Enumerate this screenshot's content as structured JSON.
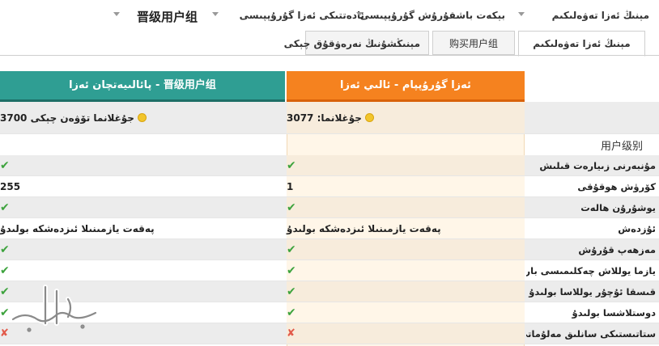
{
  "nav": {
    "crumbs": [
      "مېنىڭ ئەزا تەۋەلىكىم",
      "晋级用户组",
      "ئادەتتىكى ئەزا گۇرۇپپىسى",
      "بېكەت باشقۇرۇش گۇرۇپپىسى"
    ]
  },
  "tabs": [
    {
      "label": "مېنىڭ ئەزا تەۋەلىكىم",
      "active": true
    },
    {
      "label": "购买用户组",
      "active": false
    },
    {
      "label": "مېنىڭشۇنىڭ نەرەۋقۇق چېكى",
      "active": false
    }
  ],
  "columns": {
    "current": {
      "header": "ئەزا گۇرۇپپام - ئالىي ئەزا",
      "points_label": "جۇغلانما: 3077"
    },
    "next": {
      "header": "晋级用户组 - پائالىيەتچان ئەزا",
      "points_label": "جۇغلانما تۆۋەن چېكى 3700"
    }
  },
  "section_label": "用户级别",
  "rows": [
    {
      "label": "مۇنبەرنى زىيارەت قىلىش",
      "current": "✔",
      "next": "✔"
    },
    {
      "label": "كۆرۈش ھوقۇقى",
      "current": "1",
      "next": "255"
    },
    {
      "label": "يوشۇرۇن ھالەت",
      "current": "✔",
      "next": "✔"
    },
    {
      "label": "ئۇزدەش",
      "current": "پەقەت يازمىنىلا ئىزدەشكە بولىدۇ",
      "next": "پەقەت يازمىنىلا ئىزدەشكە بولىدۇ"
    },
    {
      "label": "مەزھەپ قۇرۇش",
      "current": "✔",
      "next": "✔"
    },
    {
      "label": "يازما يوللاش چەكلىمىسى بار",
      "current": "✔",
      "next": "✔"
    },
    {
      "label": "قىسقا ئۇچۇر يوللاسا بولىدۇ",
      "current": "✔",
      "next": "✔"
    },
    {
      "label": "دوستلاشسا بولىدۇ",
      "current": "✔",
      "next": "✔"
    },
    {
      "label": "ستاتىستىكى سانلىق مەلۇماتى",
      "current": "✘",
      "next": "✘"
    }
  ],
  "colors": {
    "teal": "#2f9e93",
    "orange": "#f5821f",
    "check": "#3da33d",
    "cross": "#e25a4a"
  },
  "icons": {
    "check": "check-icon",
    "cross": "cross-icon",
    "bulb": "lightbulb-icon",
    "dropdown": "chevron-down-icon"
  }
}
